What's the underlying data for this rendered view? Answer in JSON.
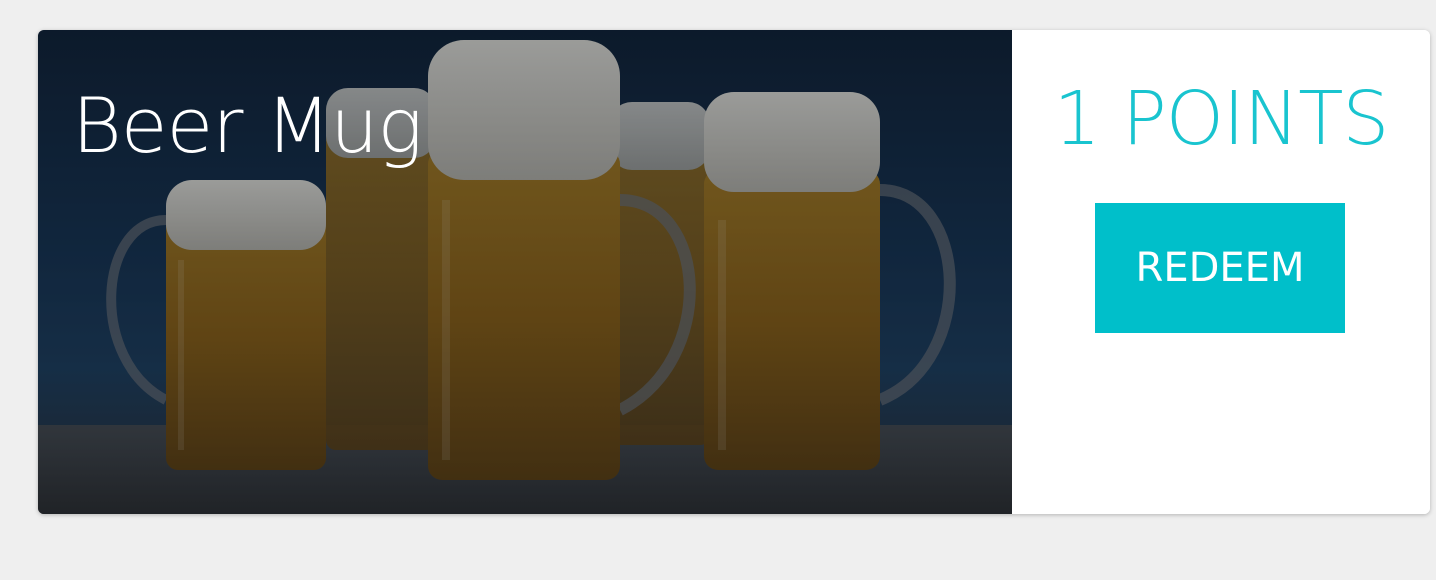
{
  "reward": {
    "title": "Beer Mug",
    "points_label": "1 POINTS",
    "redeem_label": "REDEEM",
    "image": "beer-mugs-photo"
  },
  "colors": {
    "accent": "#00bfca",
    "points_text": "#19c4cf",
    "page_background": "#efefef",
    "card_background": "#ffffff"
  }
}
